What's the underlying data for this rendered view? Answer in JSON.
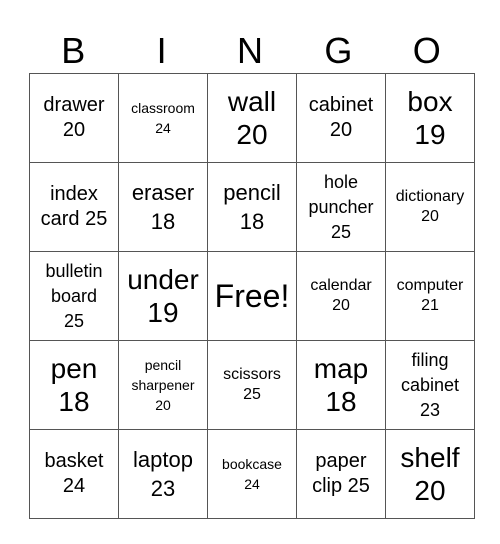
{
  "header": {
    "letters": [
      "B",
      "I",
      "N",
      "G",
      "O"
    ]
  },
  "grid": {
    "rows": [
      [
        {
          "text": "drawer\n20",
          "size": "s4"
        },
        {
          "text": "classroom\n24",
          "size": "s7"
        },
        {
          "text": "wall\n20",
          "size": "s2"
        },
        {
          "text": "cabinet\n20",
          "size": "s4"
        },
        {
          "text": "box\n19",
          "size": "s2"
        }
      ],
      [
        {
          "text": "index\ncard 25",
          "size": "s4"
        },
        {
          "text": "eraser\n18",
          "size": "s3"
        },
        {
          "text": "pencil\n18",
          "size": "s3"
        },
        {
          "text": "hole\npuncher\n25",
          "size": "s5"
        },
        {
          "text": "dictionary\n20",
          "size": "s6"
        }
      ],
      [
        {
          "text": "bulletin\nboard\n25",
          "size": "s5"
        },
        {
          "text": "under\n19",
          "size": "s2"
        },
        {
          "text": "Free!",
          "size": "s1"
        },
        {
          "text": "calendar\n20",
          "size": "s6"
        },
        {
          "text": "computer\n21",
          "size": "s6"
        }
      ],
      [
        {
          "text": "pen\n18",
          "size": "s2"
        },
        {
          "text": "pencil\nsharpener\n20",
          "size": "s7"
        },
        {
          "text": "scissors\n25",
          "size": "s6"
        },
        {
          "text": "map\n18",
          "size": "s2"
        },
        {
          "text": "filing\ncabinet\n23",
          "size": "s5"
        }
      ],
      [
        {
          "text": "basket\n24",
          "size": "s4"
        },
        {
          "text": "laptop\n23",
          "size": "s3"
        },
        {
          "text": "bookcase\n24",
          "size": "s7"
        },
        {
          "text": "paper\nclip 25",
          "size": "s4"
        },
        {
          "text": "shelf\n20",
          "size": "s2"
        }
      ]
    ]
  }
}
